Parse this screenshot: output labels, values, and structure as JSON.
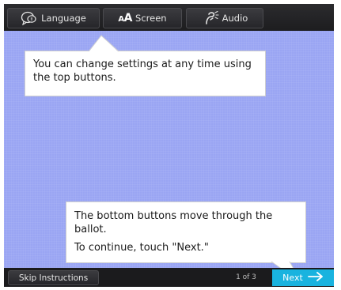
{
  "topbar": {
    "language_label": "Language",
    "screen_label": "Screen",
    "screen_glyph_small": "A",
    "screen_glyph_big": "A",
    "audio_label": "Audio"
  },
  "callouts": {
    "top_text": "You can change settings at any time using the top buttons.",
    "bottom_line1": "The bottom buttons move through the ballot.",
    "bottom_line2": "To continue, touch \"Next.\""
  },
  "bottombar": {
    "skip_label": "Skip Instructions",
    "page_indicator": "1 of 3",
    "next_label": "Next",
    "next_icon": "arrow-right-icon"
  },
  "colors": {
    "content_background": "#9aa5f3",
    "next_button": "#19b3df",
    "bar_background": "#1f1f21"
  }
}
